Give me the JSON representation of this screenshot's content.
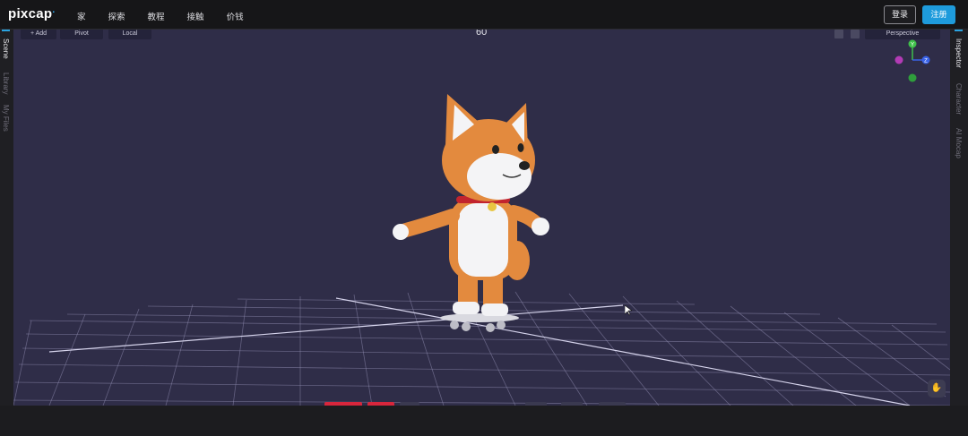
{
  "app": {
    "logo_text": "pixcap",
    "logo_mark": "."
  },
  "nav": {
    "items": [
      {
        "label": "家"
      },
      {
        "label": "探索"
      },
      {
        "label": "教程"
      },
      {
        "label": "接触"
      },
      {
        "label": "价钱"
      }
    ]
  },
  "auth": {
    "login_label": "登录",
    "register_label": "注册"
  },
  "left_panel": {
    "tabs": [
      {
        "label": "Scene",
        "active": true
      },
      {
        "label": "Library",
        "active": false
      },
      {
        "label": "My Files",
        "active": false
      }
    ]
  },
  "right_panel": {
    "tabs": [
      {
        "label": "Inspector",
        "active": true
      },
      {
        "label": "Character",
        "active": false
      },
      {
        "label": "AI Mocap",
        "active": false
      }
    ]
  },
  "viewport": {
    "toolbar": {
      "add_label": "+ Add",
      "pivot_label": "Pivot",
      "local_label": "Local"
    },
    "frame_number": "60",
    "camera_mode": "Perspective",
    "gizmo_labels": {
      "y": "Y",
      "z": "Z"
    },
    "background_color": "#2f2d48",
    "grid_color": "#8f8db0"
  },
  "timeline": {
    "accent_color": "#d8263c"
  }
}
